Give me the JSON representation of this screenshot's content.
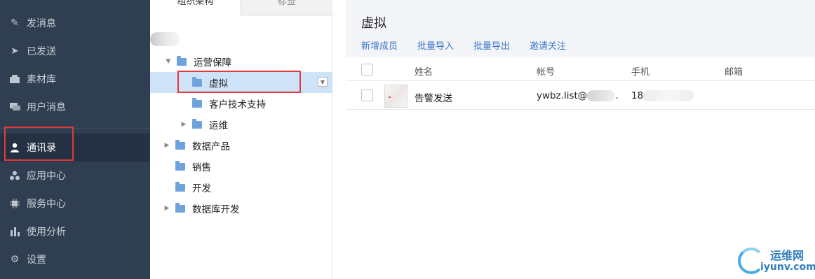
{
  "sidebar": {
    "items": [
      {
        "label": "发消息",
        "icon": "pencil-icon"
      },
      {
        "label": "已发送",
        "icon": "send-icon"
      },
      {
        "label": "素材库",
        "icon": "box-icon"
      },
      {
        "label": "用户消息",
        "icon": "chat-icon"
      },
      {
        "label": "通讯录",
        "icon": "person-icon"
      },
      {
        "label": "应用中心",
        "icon": "apps-icon"
      },
      {
        "label": "服务中心",
        "icon": "chip-icon"
      },
      {
        "label": "使用分析",
        "icon": "bar-chart-icon"
      },
      {
        "label": "设置",
        "icon": "gear-icon"
      }
    ],
    "active_index": 4
  },
  "tree_panel": {
    "tabs": [
      "组织架构",
      "标签"
    ],
    "nodes": [
      {
        "label": "运营保障",
        "expanded": true
      },
      {
        "label": "虚拟",
        "selected": true
      },
      {
        "label": "客户技术支持"
      },
      {
        "label": "运维",
        "expanded": false
      },
      {
        "label": "数据产品",
        "expanded": false
      },
      {
        "label": "销售"
      },
      {
        "label": "开发"
      },
      {
        "label": "数据库开发",
        "expanded": false
      }
    ]
  },
  "main": {
    "title": "虚拟",
    "actions": [
      "新增成员",
      "批量导入",
      "批量导出",
      "邀请关注"
    ],
    "columns": [
      "姓名",
      "帐号",
      "手机",
      "邮箱"
    ],
    "rows": [
      {
        "name": "告警发送",
        "account": "ywbz.list@",
        "account_tail": ".",
        "phone": "18",
        "email": ""
      }
    ]
  },
  "watermark": {
    "text1": "运维网",
    "text2": "iyunv.com"
  },
  "colors": {
    "sidebar_bg": "#2f3e50",
    "accent": "#3f78c8",
    "highlight": "#e23a3a",
    "selected_row": "#cfe3f8"
  }
}
